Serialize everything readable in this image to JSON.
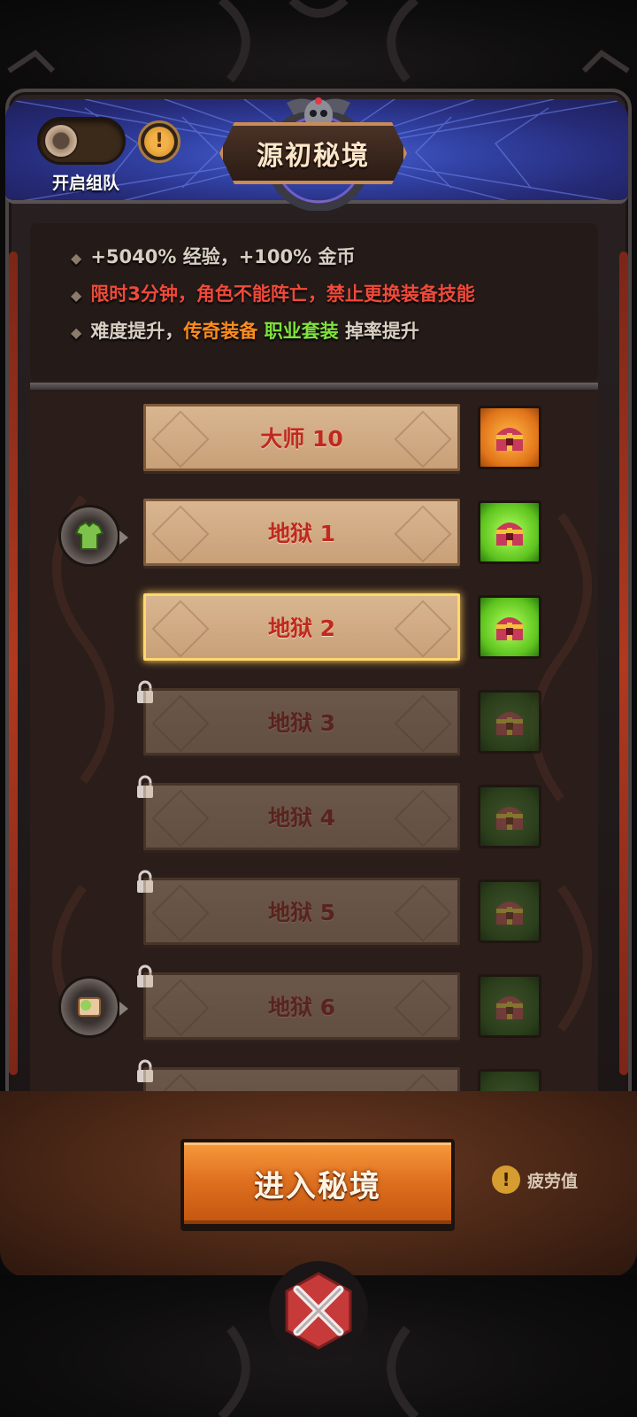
{
  "header": {
    "title": "源初秘境",
    "team_toggle_label": "开启组队"
  },
  "info": {
    "line1": "+5040% 经验，+100% 金币",
    "line2": "限时3分钟，角色不能阵亡，禁止更换装备技能",
    "line3_prefix": "难度提升，",
    "line3_legend": "传奇装备",
    "line3_set": "职业套装",
    "line3_suffix": "掉率提升"
  },
  "levels": [
    {
      "label": "大师 10",
      "chest": "orange",
      "locked": false,
      "selected": false
    },
    {
      "label": "地狱 1",
      "chest": "green",
      "locked": false,
      "selected": false
    },
    {
      "label": "地狱 2",
      "chest": "green",
      "locked": false,
      "selected": true
    },
    {
      "label": "地狱 3",
      "chest": "green",
      "locked": true,
      "selected": false
    },
    {
      "label": "地狱 4",
      "chest": "green",
      "locked": true,
      "selected": false
    },
    {
      "label": "地狱 5",
      "chest": "green",
      "locked": true,
      "selected": false
    },
    {
      "label": "地狱 6",
      "chest": "green",
      "locked": true,
      "selected": false
    }
  ],
  "actions": {
    "enter_label": "进入秘境",
    "fatigue_label": "疲劳值"
  },
  "colors": {
    "warning_text": "#ef4a3a",
    "legendary": "#ff8c1e",
    "set": "#7fe23c",
    "level_text": "#c0291f",
    "enter_button": "#e07121"
  },
  "icons": {
    "reward_badge_1": "armor-shirt-icon",
    "reward_badge_2": "scroll-icon",
    "chest": "treasure-chest-icon",
    "lock": "lock-icon",
    "close": "crossed-swords-close-icon"
  }
}
